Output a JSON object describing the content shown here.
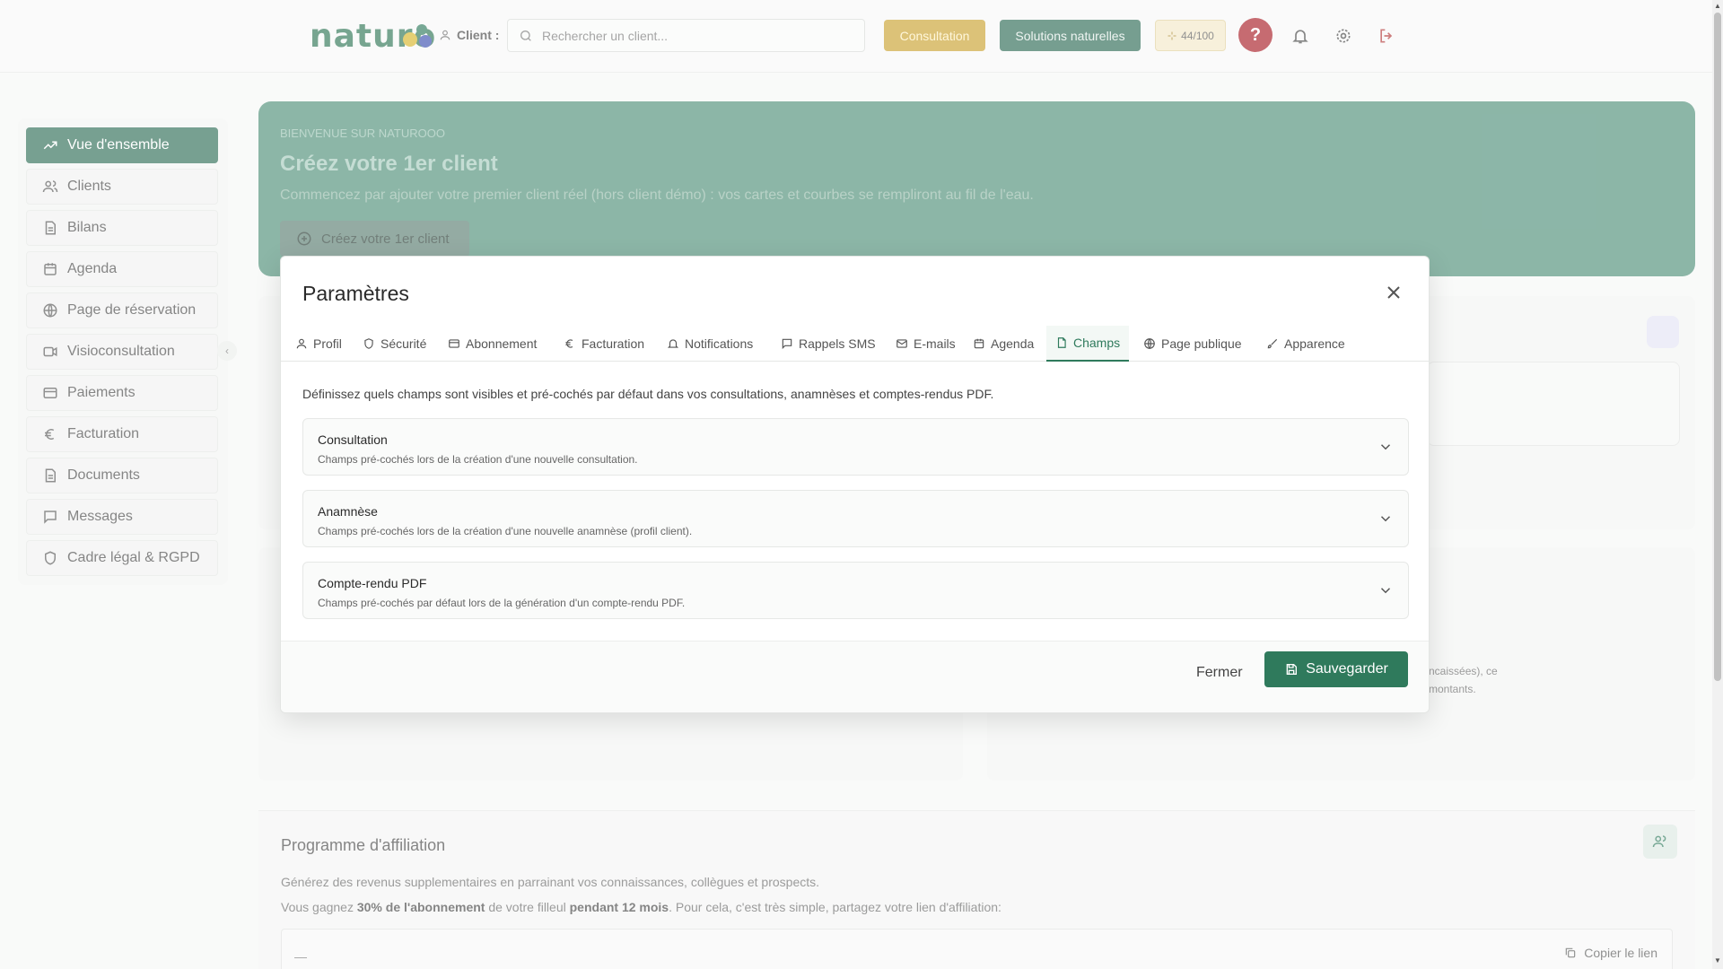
{
  "header": {
    "logo": "naturo",
    "client_label": "Client :",
    "search_placeholder": "Rechercher un client...",
    "consultation_label": "Consultation",
    "solutions_label": "Solutions naturelles",
    "score": "44/100",
    "help_glyph": "?",
    "brand_color": "#2f7a5c",
    "accent_color": "#c9a231"
  },
  "sidebar": {
    "items": [
      {
        "label": "Vue d'ensemble",
        "icon": "trending-up-icon"
      },
      {
        "label": "Clients",
        "icon": "users-icon"
      },
      {
        "label": "Bilans",
        "icon": "document-icon"
      },
      {
        "label": "Agenda",
        "icon": "calendar-icon"
      },
      {
        "label": "Page de réservation",
        "icon": "globe-icon"
      },
      {
        "label": "Visioconsultation",
        "icon": "video-icon"
      },
      {
        "label": "Paiements",
        "icon": "card-icon"
      },
      {
        "label": "Facturation",
        "icon": "euro-icon"
      },
      {
        "label": "Documents",
        "icon": "document-icon"
      },
      {
        "label": "Messages",
        "icon": "message-icon"
      },
      {
        "label": "Cadre légal & RGPD",
        "icon": "shield-icon"
      }
    ]
  },
  "banner": {
    "kicker": "BIENVENUE SUR NATUROOO",
    "title": "Créez votre 1er client",
    "subtitle": "Commencez par ajouter votre premier client réel (hors client démo) : vos cartes et courbes se rempliront au fil de l'eau.",
    "cta": "Créez votre 1er client"
  },
  "affiliation": {
    "title": "Programme d'affiliation",
    "line1": "Générez des revenus supplementaires en parrainant vos connaissances, collègues et prospects.",
    "line2_a": "Vous gagnez ",
    "line2_b": "30% de l'abonnement",
    "line2_c": " de votre filleul ",
    "line2_d": "pendant 12 mois",
    "line2_e": ". Pour cela, c'est très simple, partagez votre lien d'affiliation:",
    "link_value": "—",
    "copy_label": "Copier le lien"
  },
  "background_fragments": {
    "text_a": "ncaissées), ce",
    "text_b": "montants."
  },
  "modal": {
    "title": "Paramètres",
    "tabs": [
      {
        "label": "Profil",
        "icon": "user-icon"
      },
      {
        "label": "Sécurité",
        "icon": "shield-icon"
      },
      {
        "label": "Abonnement",
        "icon": "card-icon"
      },
      {
        "label": "Facturation",
        "icon": "euro-icon"
      },
      {
        "label": "Notifications",
        "icon": "bell-icon"
      },
      {
        "label": "Rappels SMS",
        "icon": "message-icon"
      },
      {
        "label": "E-mails",
        "icon": "mail-icon"
      },
      {
        "label": "Agenda",
        "icon": "calendar-icon"
      },
      {
        "label": "Champs",
        "icon": "file-icon"
      },
      {
        "label": "Page publique",
        "icon": "globe-icon"
      },
      {
        "label": "Apparence",
        "icon": "brush-icon"
      }
    ],
    "active_tab": "Champs",
    "description": "Définissez quels champs sont visibles et pré-cochés par défaut dans vos consultations, anamnèses et comptes-rendus PDF.",
    "sections": [
      {
        "title": "Consultation",
        "subtitle": "Champs pré-cochés lors de la création d'une nouvelle consultation."
      },
      {
        "title": "Anamnèse",
        "subtitle": "Champs pré-cochés lors de la création d'une nouvelle anamnèse (profil client)."
      },
      {
        "title": "Compte-rendu PDF",
        "subtitle": "Champs pré-cochés par défaut lors de la génération d'un compte-rendu PDF."
      }
    ],
    "close_label": "Fermer",
    "save_label": "Sauvegarder"
  }
}
